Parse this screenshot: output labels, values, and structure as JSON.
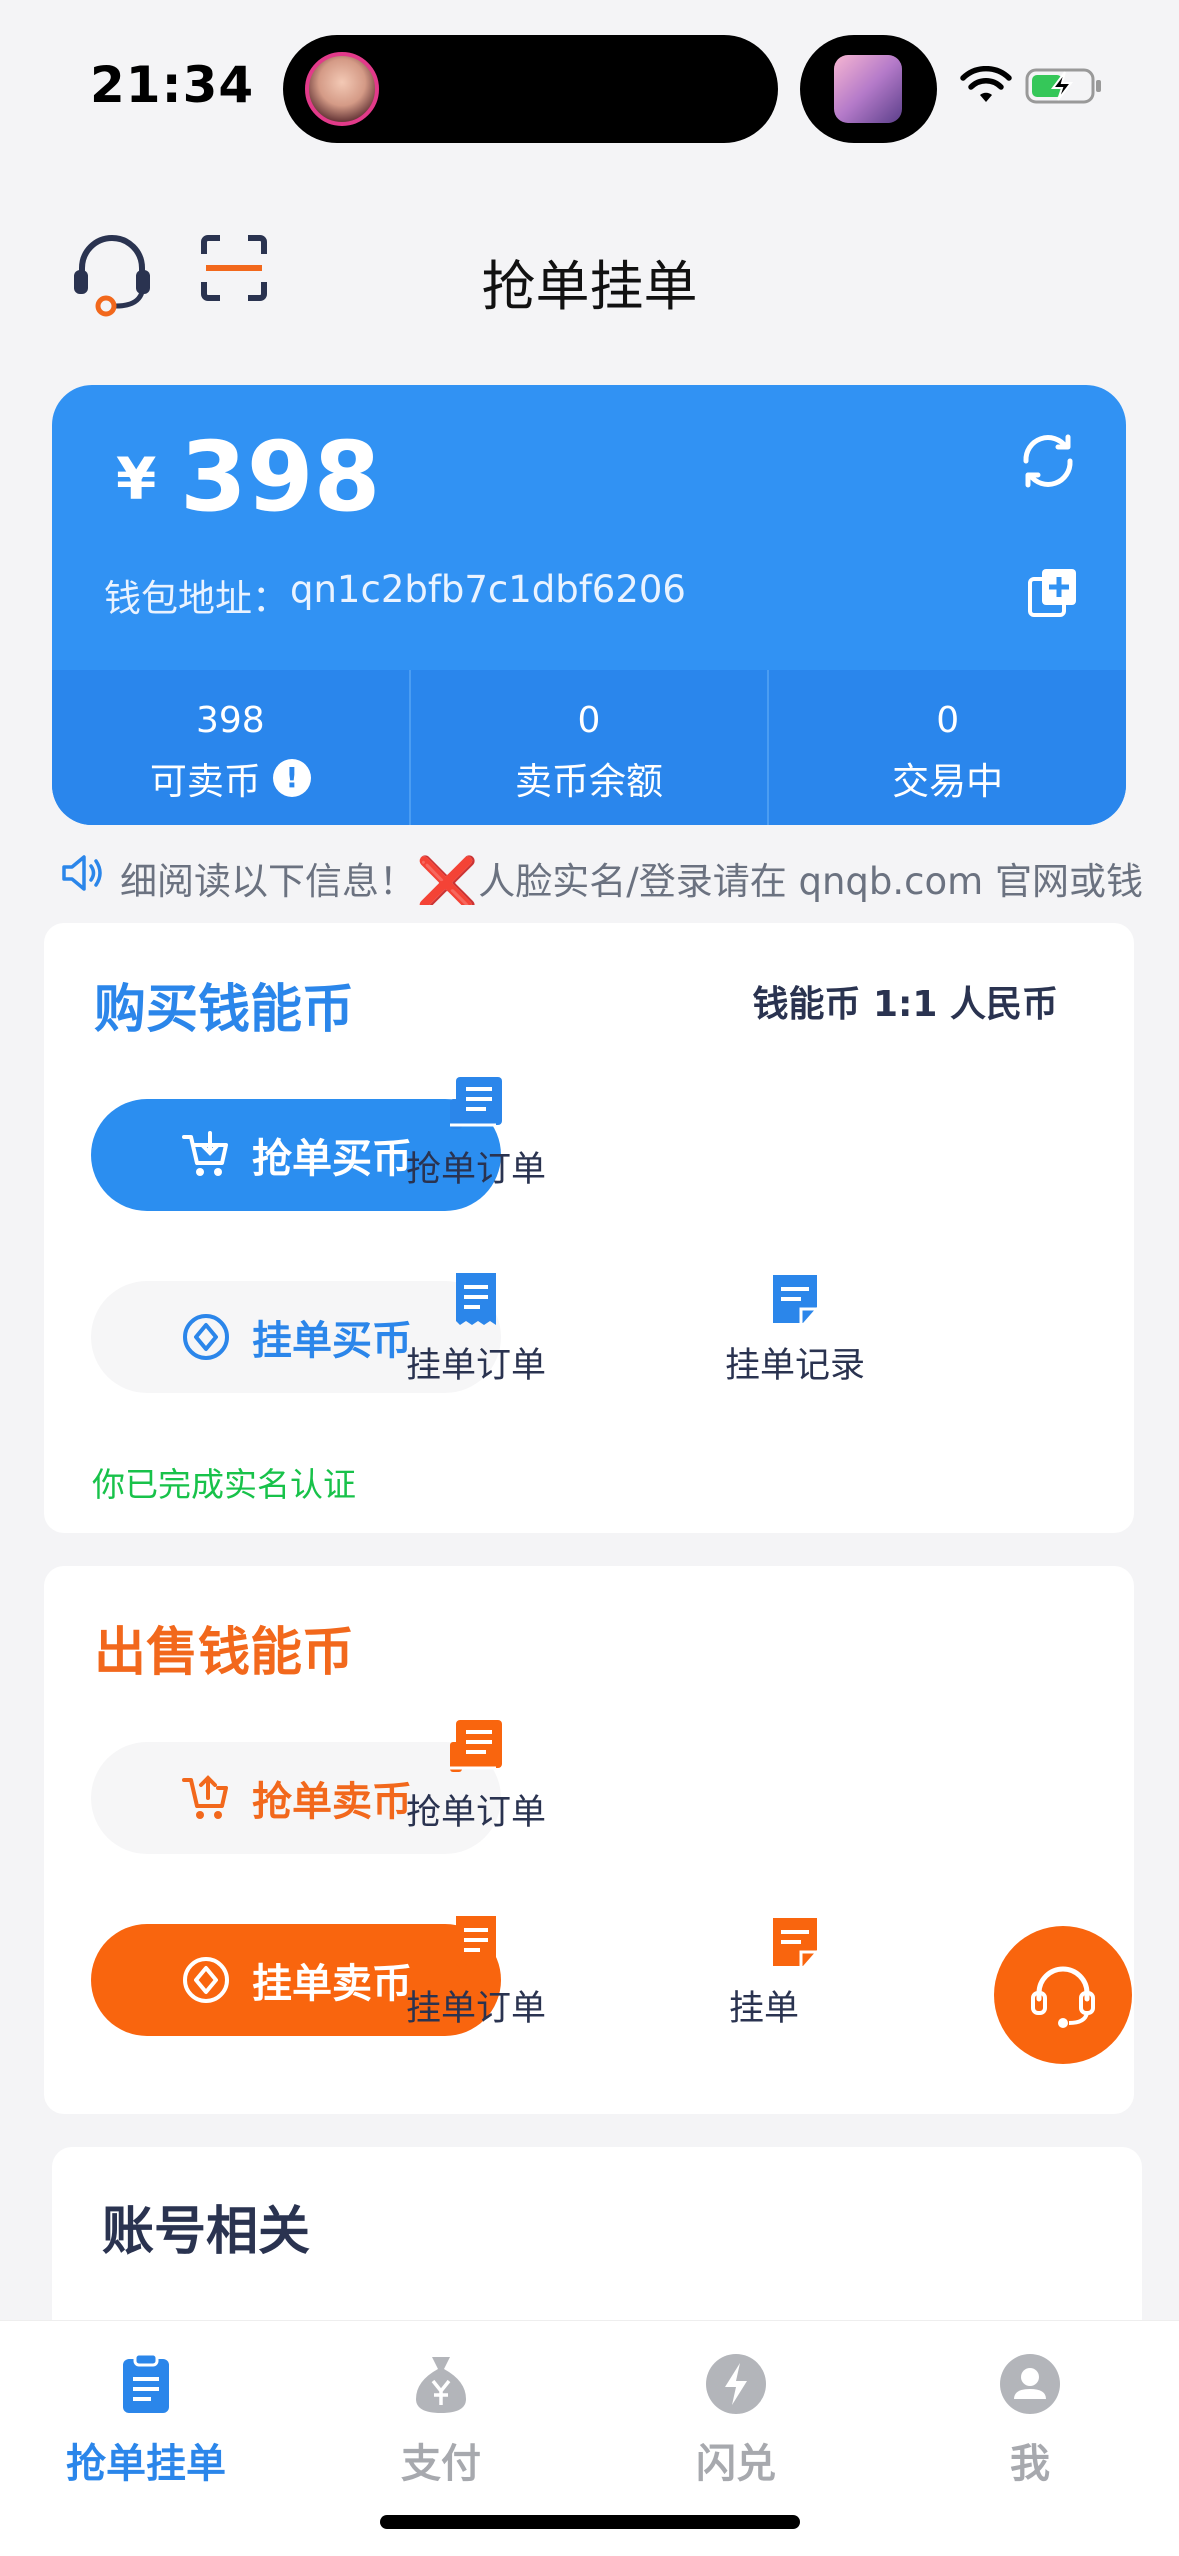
{
  "status_bar": {
    "time": "21:34"
  },
  "header": {
    "title": "抢单挂单",
    "support_icon": "headset-icon",
    "scan_icon": "scan-icon"
  },
  "wallet": {
    "currency": "¥",
    "balance": "398",
    "address_label": "钱包地址：",
    "address": "qn1c2bfb7c1dbf6206",
    "stats": [
      {
        "value": "398",
        "label": "可卖币"
      },
      {
        "value": "0",
        "label": "卖币余额"
      },
      {
        "value": "0",
        "label": "交易中"
      }
    ],
    "info_glyph": "!"
  },
  "notice": {
    "text_before": "细阅读以下信息！",
    "x_mark": "❌",
    "text_after": "人脸实名/登录请在 qnqb.com 官网或钱"
  },
  "buy": {
    "title": "购买钱能币",
    "rate": "钱能币 1:1 人民币",
    "grab_button": "抢单买币",
    "list_button": "挂单买币",
    "grab_orders": "抢单订单",
    "list_orders": "挂单订单",
    "list_records": "挂单记录",
    "verified": "你已完成实名认证"
  },
  "sell": {
    "title": "出售钱能币",
    "grab_button": "抢单卖币",
    "list_button": "挂单卖币",
    "grab_orders": "抢单订单",
    "list_orders": "挂单订单",
    "list_records": "挂单"
  },
  "account": {
    "title": "账号相关"
  },
  "tabbar": {
    "items": [
      {
        "label": "抢单挂单",
        "icon": "clipboard-icon"
      },
      {
        "label": "支付",
        "icon": "money-bag-icon"
      },
      {
        "label": "闪兑",
        "icon": "lightning-icon"
      },
      {
        "label": "我",
        "icon": "user-icon"
      }
    ]
  },
  "colors": {
    "blue": "#2b86ea",
    "orange": "#f9650e",
    "green": "#18c24a"
  }
}
